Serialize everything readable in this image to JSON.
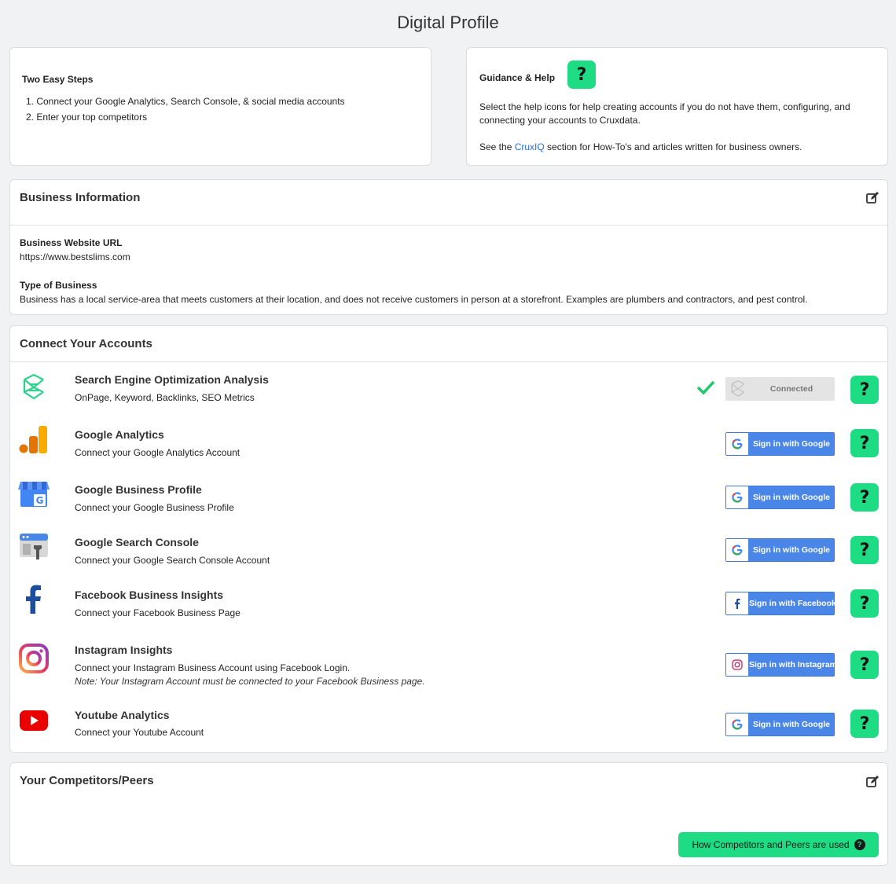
{
  "page": {
    "title": "Digital Profile"
  },
  "steps": {
    "title": "Two Easy Steps",
    "items": [
      "1. Connect your Google Analytics, Search Console, & social media accounts",
      "2. Enter your top competitors"
    ]
  },
  "guidance": {
    "title": "Guidance & Help",
    "help_label": "?",
    "p1": "Select the help icons for help creating accounts if you do not have them, configuring, and connecting your accounts to Cruxdata.",
    "p2_before": "See the ",
    "p2_link": "CruxIQ",
    "p2_after": " section for How-To's and articles written for business owners."
  },
  "business": {
    "title": "Business Information",
    "url_label": "Business Website URL",
    "url_value": "https://www.bestslims.com",
    "type_label": "Type of Business",
    "type_value": "Business has a local service-area that meets customers at their location, and does not receive customers in person at a storefront. Examples are plumbers and contractors, and pest control."
  },
  "accounts": {
    "title": "Connect Your Accounts",
    "help_label": "?",
    "rows": [
      {
        "icon": "cruxdata-logo-icon",
        "title": "Search Engine Optimization Analysis",
        "sub": "OnPage, Keyword, Backlinks, SEO Metrics",
        "status": "Connected"
      },
      {
        "icon": "google-analytics-icon",
        "title": "Google Analytics",
        "sub": "Connect your Google Analytics Account",
        "button": "Sign in with Google"
      },
      {
        "icon": "google-business-icon",
        "title": "Google Business Profile",
        "sub": "Connect your Google Business Profile",
        "button": "Sign in with Google"
      },
      {
        "icon": "google-search-console-icon",
        "title": "Google Search Console",
        "sub": "Connect your Google Search Console Account",
        "button": "Sign in with Google"
      },
      {
        "icon": "facebook-icon",
        "title": "Facebook Business Insights",
        "sub": "Connect your Facebook Business Page",
        "button": "Sign in with Facebook"
      },
      {
        "icon": "instagram-icon",
        "title": "Instagram Insights",
        "sub": "Connect your Instagram Business Account using Facebook Login.",
        "note": "Note: Your Instagram Account must be connected to your Facebook Business page.",
        "button": "Sign in with Instagram"
      },
      {
        "icon": "youtube-icon",
        "title": "Youtube Analytics",
        "sub": "Connect your Youtube Account",
        "button": "Sign in with Google"
      }
    ]
  },
  "competitors": {
    "title": "Your Competitors/Peers",
    "button": "How Competitors and Peers are used",
    "button_icon": "?"
  },
  "colors": {
    "accent_green": "#1edc84",
    "google_blue": "#4a86e8",
    "link_blue": "#2a6fd6"
  }
}
